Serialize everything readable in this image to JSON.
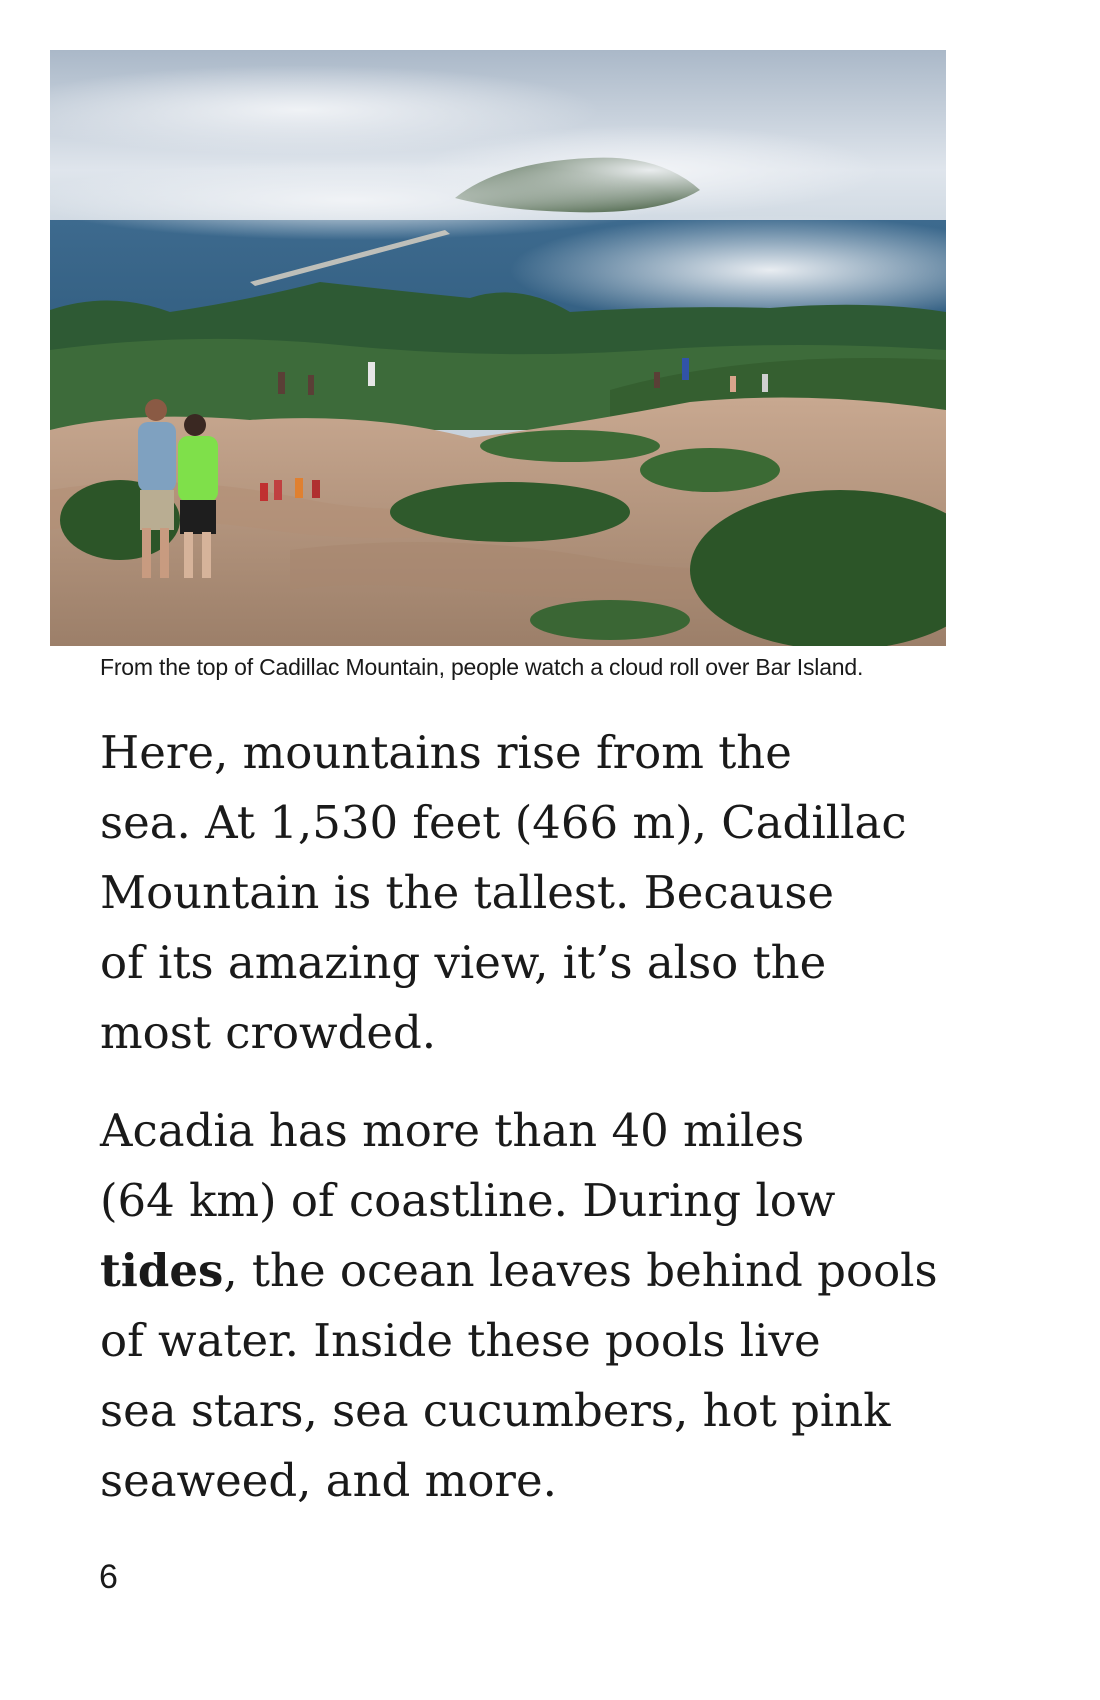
{
  "photo": {
    "alt": "People on the rocky summit of Cadillac Mountain watching a cloud roll over Bar Island"
  },
  "caption": "From the top of Cadillac Mountain, people watch a cloud roll over Bar Island.",
  "paragraph1": {
    "lines": [
      "Here, mountains rise from the",
      "sea. At 1,530 feet (466 m), Cadillac",
      "Mountain is the tallest. Because",
      "of its amazing view, it’s also the",
      "most crowded."
    ]
  },
  "paragraph2": {
    "line1": "Acadia has more than 40 miles",
    "line2": "(64 km) of coastline. During low",
    "line3_term": "tides",
    "line3_rest": ", the ocean leaves behind pools",
    "line4": "of water. Inside these pools live",
    "line5": "sea stars, sea cucumbers, hot pink",
    "line6": "seaweed, and more."
  },
  "page_number": "6"
}
